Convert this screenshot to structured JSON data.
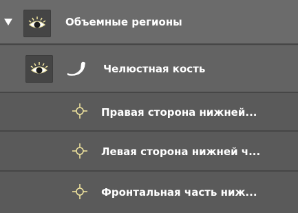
{
  "tree": {
    "group": {
      "label": "Объемные регионы",
      "expanded": true,
      "icon": "eye-icon"
    },
    "items": [
      {
        "label": "Челюстная кость",
        "icon": "jaw-bone-icon",
        "visibility_icon": "eye-icon"
      },
      {
        "label": "Правая сторона нижней...",
        "icon": "crosshair-icon"
      },
      {
        "label": "Левая сторона нижней ч...",
        "icon": "crosshair-icon"
      },
      {
        "label": "Фронтальная часть ниж...",
        "icon": "crosshair-icon"
      }
    ]
  },
  "colors": {
    "header_bg": "#6b6b6b",
    "selected_bg": "#636363",
    "row_bg": "#5a5a5a",
    "divider": "#464646",
    "text": "#ffffff",
    "icon_yellow": "#f4e8a0"
  }
}
